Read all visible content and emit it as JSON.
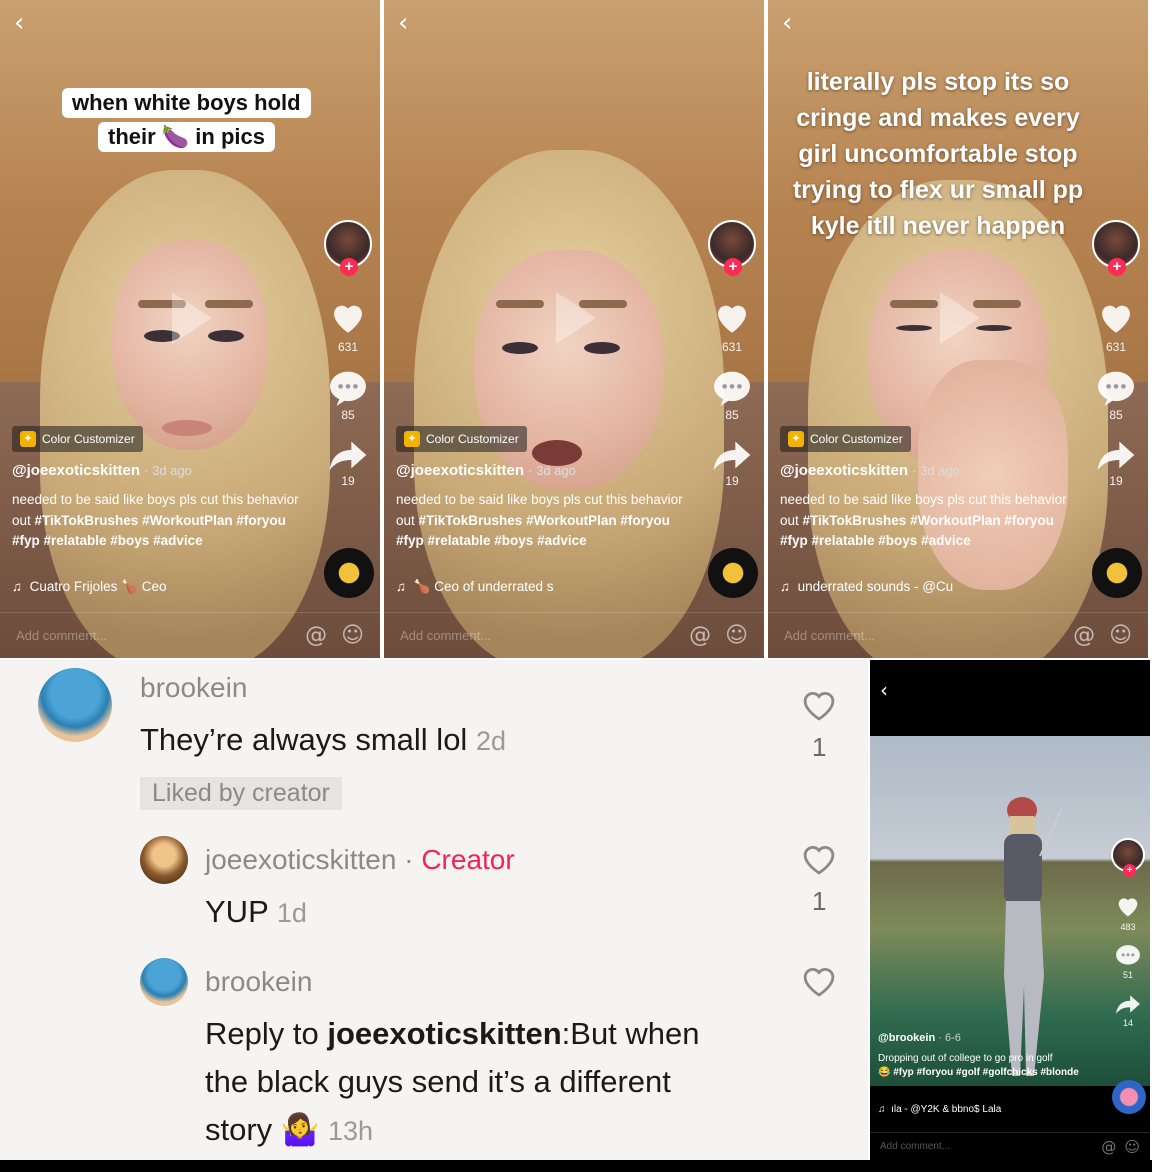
{
  "panels": [
    {
      "caption": [
        "when white boys hold",
        "their 🍆 in pics"
      ],
      "likes": "631",
      "comments": "85",
      "shares": "19",
      "effect": "Color Customizer",
      "username": "@joeexoticskitten",
      "ago": "· 3d ago",
      "desc_plain1": "needed to be said like boys pls cut this behavior out ",
      "tags1": "#TikTokBrushes #WorkoutPlan #foryou #fyp #relatable #boys #advice",
      "music": "Cuatro Frijoles 🍗   Ceo",
      "comment_placeholder": "Add comment..."
    },
    {
      "caption": [],
      "likes": "631",
      "comments": "85",
      "shares": "19",
      "effect": "Color Customizer",
      "username": "@joeexoticskitten",
      "ago": "· 3d ago",
      "desc_plain1": "needed to be said like boys pls cut this behavior out ",
      "tags1": "#TikTokBrushes #WorkoutPlan #foryou #fyp #relatable #boys #advice",
      "music": "🍗   Ceo of underrated s",
      "comment_placeholder": "Add comment..."
    },
    {
      "caption": [
        "literally pls stop its so",
        "cringe and makes every",
        "girl uncomfortable stop",
        "trying to flex ur small pp",
        "kyle itll never happen"
      ],
      "likes": "631",
      "comments": "85",
      "shares": "19",
      "effect": "Color Customizer",
      "username": "@joeexoticskitten",
      "ago": "· 3d ago",
      "desc_plain1": "needed to be said like boys pls cut this behavior out ",
      "tags1": "#TikTokBrushes #WorkoutPlan #foryou #fyp #relatable #boys #advice",
      "music": "underrated sounds - @Cu",
      "comment_placeholder": "Add comment..."
    }
  ],
  "comments": [
    {
      "name": "brookein",
      "text": "They’re always small lol",
      "time": "2d",
      "liked_by": "Liked by creator",
      "likes": "1"
    },
    {
      "name": "joeexoticskitten",
      "sep": " · ",
      "badge": "Creator",
      "text": "YUP",
      "time": "1d",
      "likes": "1"
    },
    {
      "name": "brookein",
      "reply_prefix": "Reply to ",
      "reply_to": "joeexoticskitten",
      "text_parts": [
        ":But when",
        "the black guys send it’s a different",
        "story 🤷‍♀️"
      ],
      "time": "13h"
    }
  ],
  "golf": {
    "likes": "483",
    "comments": "51",
    "shares": "14",
    "username": "@brookein",
    "ago": "· 6-6",
    "desc": "Dropping out of college to go pro in golf",
    "tags": "😂 #fyp #foryou #golf #golfchicks #blonde",
    "music": "ıla - @Y2K & bbno$   Lala",
    "comment_placeholder": "Add comment..."
  },
  "colors": {
    "accent": "#fe2c55",
    "creator": "#f0245a"
  }
}
